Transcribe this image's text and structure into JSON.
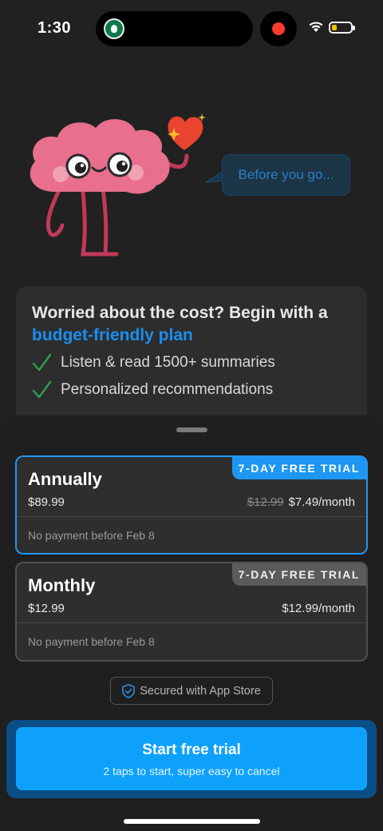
{
  "status_bar": {
    "time": "1:30",
    "island_app_icon": "starbucks-icon",
    "recording_color": "#ff3b30",
    "battery_color": "#ffcc00"
  },
  "mascot": {
    "icon": "brain-character-icon",
    "speech": "Before you go..."
  },
  "info_card": {
    "headline_prefix": "Worried about the cost? Begin with a ",
    "headline_accent": "budget-friendly plan",
    "features": [
      "Listen & read 1500+ summaries",
      "Personalized recommendations"
    ]
  },
  "plans": [
    {
      "name": "Annually",
      "price": "$89.99",
      "old_monthly": "$12.99",
      "monthly": "$7.49/month",
      "badge": "7-DAY FREE TRIAL",
      "note": "No payment before Feb 8",
      "selected": true
    },
    {
      "name": "Monthly",
      "price": "$12.99",
      "monthly": "$12.99/month",
      "badge": "7-DAY FREE TRIAL",
      "note": "No payment before Feb 8",
      "selected": false
    }
  ],
  "secured_label": "Secured with App Store",
  "cta": {
    "title": "Start free trial",
    "subtitle": "2 taps to start, super easy to cancel"
  },
  "colors": {
    "accent": "#1a8ff0",
    "cta": "#0ea1fb",
    "check": "#2e9e4f",
    "selected_border": "#2196f3"
  }
}
